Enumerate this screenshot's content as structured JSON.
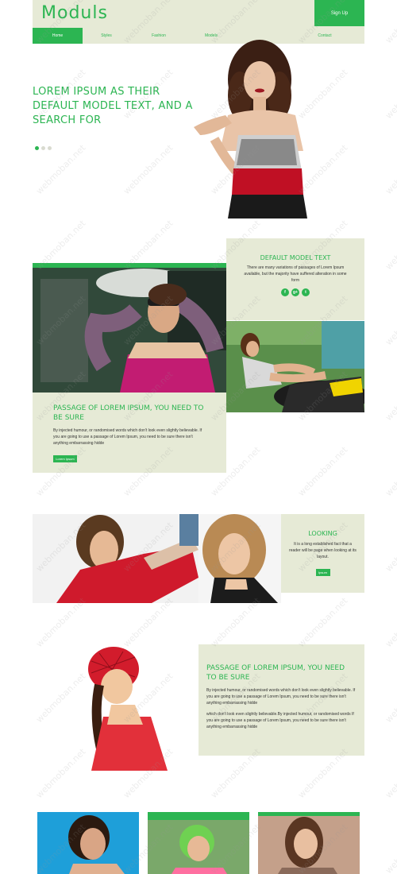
{
  "header": {
    "logo": "Moduls",
    "signup_label": "Sign Up"
  },
  "nav": {
    "items": [
      {
        "label": "Home",
        "active": true
      },
      {
        "label": "Styles",
        "active": false
      },
      {
        "label": "Fashion",
        "active": false
      },
      {
        "label": "Models",
        "active": false
      },
      {
        "label": "Contact",
        "active": false
      }
    ]
  },
  "hero": {
    "headline": "Lorem Ipsum as their default model text, and a search for",
    "slide_count": 3,
    "active_slide": 1
  },
  "section2": {
    "panel_title": "Default model text",
    "panel_text": "There are many variations of passages of Lorem Ipsum available, but the majority have suffered alteration in some form",
    "social": [
      "f",
      "g+",
      "t"
    ],
    "card_title": "Passage of Lorem Ipsum, you need to be sure",
    "card_text": "By injected humour, or randomised words which don't look even slightly believable. If you are going to use a passage of Lorem Ipsum, you need to be sure there isn't anything embarrassing hidde",
    "card_button": "Lorem Ipsum"
  },
  "section3": {
    "title": "Looking",
    "text": "It is a long established fact that a reader will be page when looking at its layout.",
    "button": "Ipsum"
  },
  "section4": {
    "title": "Passage of Lorem Ipsum, you need to be sure",
    "text1": "By injected humour, or randomised words which don't look even slightly believable. If you are going to use a passage of Lorem Ipsum, you need to be sure there isn't anything embarrassing hidde",
    "text2": "which don't look even slightly believable.By injected humour, or randomised words If you are going to use a passage of Lorem Ipsum, you need to be sure there isn't anything embarrassing hidde"
  },
  "watermark": "webmoban.net",
  "colors": {
    "accent": "#2cb552",
    "panel": "#e6ead6"
  }
}
